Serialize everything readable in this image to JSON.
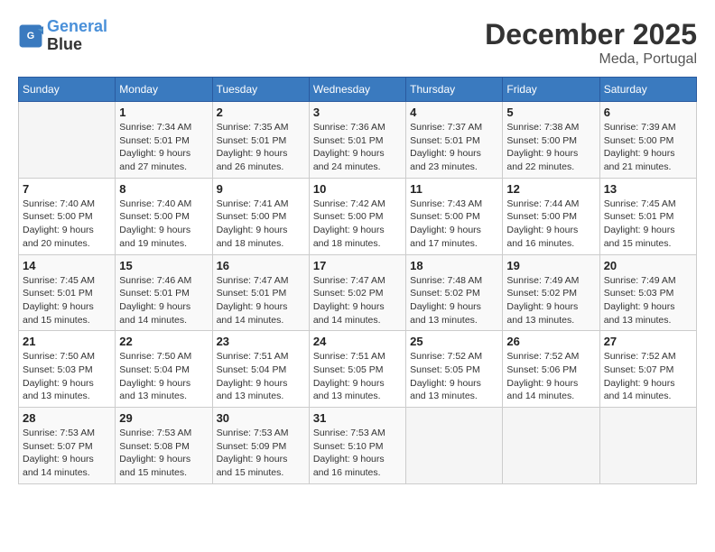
{
  "logo": {
    "line1": "General",
    "line2": "Blue"
  },
  "title": "December 2025",
  "location": "Meda, Portugal",
  "weekdays": [
    "Sunday",
    "Monday",
    "Tuesday",
    "Wednesday",
    "Thursday",
    "Friday",
    "Saturday"
  ],
  "weeks": [
    [
      null,
      {
        "day": 1,
        "sunrise": "7:34 AM",
        "sunset": "5:01 PM",
        "daylight": "9 hours and 27 minutes."
      },
      {
        "day": 2,
        "sunrise": "7:35 AM",
        "sunset": "5:01 PM",
        "daylight": "9 hours and 26 minutes."
      },
      {
        "day": 3,
        "sunrise": "7:36 AM",
        "sunset": "5:01 PM",
        "daylight": "9 hours and 24 minutes."
      },
      {
        "day": 4,
        "sunrise": "7:37 AM",
        "sunset": "5:01 PM",
        "daylight": "9 hours and 23 minutes."
      },
      {
        "day": 5,
        "sunrise": "7:38 AM",
        "sunset": "5:00 PM",
        "daylight": "9 hours and 22 minutes."
      },
      {
        "day": 6,
        "sunrise": "7:39 AM",
        "sunset": "5:00 PM",
        "daylight": "9 hours and 21 minutes."
      }
    ],
    [
      {
        "day": 7,
        "sunrise": "7:40 AM",
        "sunset": "5:00 PM",
        "daylight": "9 hours and 20 minutes."
      },
      {
        "day": 8,
        "sunrise": "7:40 AM",
        "sunset": "5:00 PM",
        "daylight": "9 hours and 19 minutes."
      },
      {
        "day": 9,
        "sunrise": "7:41 AM",
        "sunset": "5:00 PM",
        "daylight": "9 hours and 18 minutes."
      },
      {
        "day": 10,
        "sunrise": "7:42 AM",
        "sunset": "5:00 PM",
        "daylight": "9 hours and 18 minutes."
      },
      {
        "day": 11,
        "sunrise": "7:43 AM",
        "sunset": "5:00 PM",
        "daylight": "9 hours and 17 minutes."
      },
      {
        "day": 12,
        "sunrise": "7:44 AM",
        "sunset": "5:00 PM",
        "daylight": "9 hours and 16 minutes."
      },
      {
        "day": 13,
        "sunrise": "7:45 AM",
        "sunset": "5:01 PM",
        "daylight": "9 hours and 15 minutes."
      }
    ],
    [
      {
        "day": 14,
        "sunrise": "7:45 AM",
        "sunset": "5:01 PM",
        "daylight": "9 hours and 15 minutes."
      },
      {
        "day": 15,
        "sunrise": "7:46 AM",
        "sunset": "5:01 PM",
        "daylight": "9 hours and 14 minutes."
      },
      {
        "day": 16,
        "sunrise": "7:47 AM",
        "sunset": "5:01 PM",
        "daylight": "9 hours and 14 minutes."
      },
      {
        "day": 17,
        "sunrise": "7:47 AM",
        "sunset": "5:02 PM",
        "daylight": "9 hours and 14 minutes."
      },
      {
        "day": 18,
        "sunrise": "7:48 AM",
        "sunset": "5:02 PM",
        "daylight": "9 hours and 13 minutes."
      },
      {
        "day": 19,
        "sunrise": "7:49 AM",
        "sunset": "5:02 PM",
        "daylight": "9 hours and 13 minutes."
      },
      {
        "day": 20,
        "sunrise": "7:49 AM",
        "sunset": "5:03 PM",
        "daylight": "9 hours and 13 minutes."
      }
    ],
    [
      {
        "day": 21,
        "sunrise": "7:50 AM",
        "sunset": "5:03 PM",
        "daylight": "9 hours and 13 minutes."
      },
      {
        "day": 22,
        "sunrise": "7:50 AM",
        "sunset": "5:04 PM",
        "daylight": "9 hours and 13 minutes."
      },
      {
        "day": 23,
        "sunrise": "7:51 AM",
        "sunset": "5:04 PM",
        "daylight": "9 hours and 13 minutes."
      },
      {
        "day": 24,
        "sunrise": "7:51 AM",
        "sunset": "5:05 PM",
        "daylight": "9 hours and 13 minutes."
      },
      {
        "day": 25,
        "sunrise": "7:52 AM",
        "sunset": "5:05 PM",
        "daylight": "9 hours and 13 minutes."
      },
      {
        "day": 26,
        "sunrise": "7:52 AM",
        "sunset": "5:06 PM",
        "daylight": "9 hours and 14 minutes."
      },
      {
        "day": 27,
        "sunrise": "7:52 AM",
        "sunset": "5:07 PM",
        "daylight": "9 hours and 14 minutes."
      }
    ],
    [
      {
        "day": 28,
        "sunrise": "7:53 AM",
        "sunset": "5:07 PM",
        "daylight": "9 hours and 14 minutes."
      },
      {
        "day": 29,
        "sunrise": "7:53 AM",
        "sunset": "5:08 PM",
        "daylight": "9 hours and 15 minutes."
      },
      {
        "day": 30,
        "sunrise": "7:53 AM",
        "sunset": "5:09 PM",
        "daylight": "9 hours and 15 minutes."
      },
      {
        "day": 31,
        "sunrise": "7:53 AM",
        "sunset": "5:10 PM",
        "daylight": "9 hours and 16 minutes."
      },
      null,
      null,
      null
    ]
  ]
}
